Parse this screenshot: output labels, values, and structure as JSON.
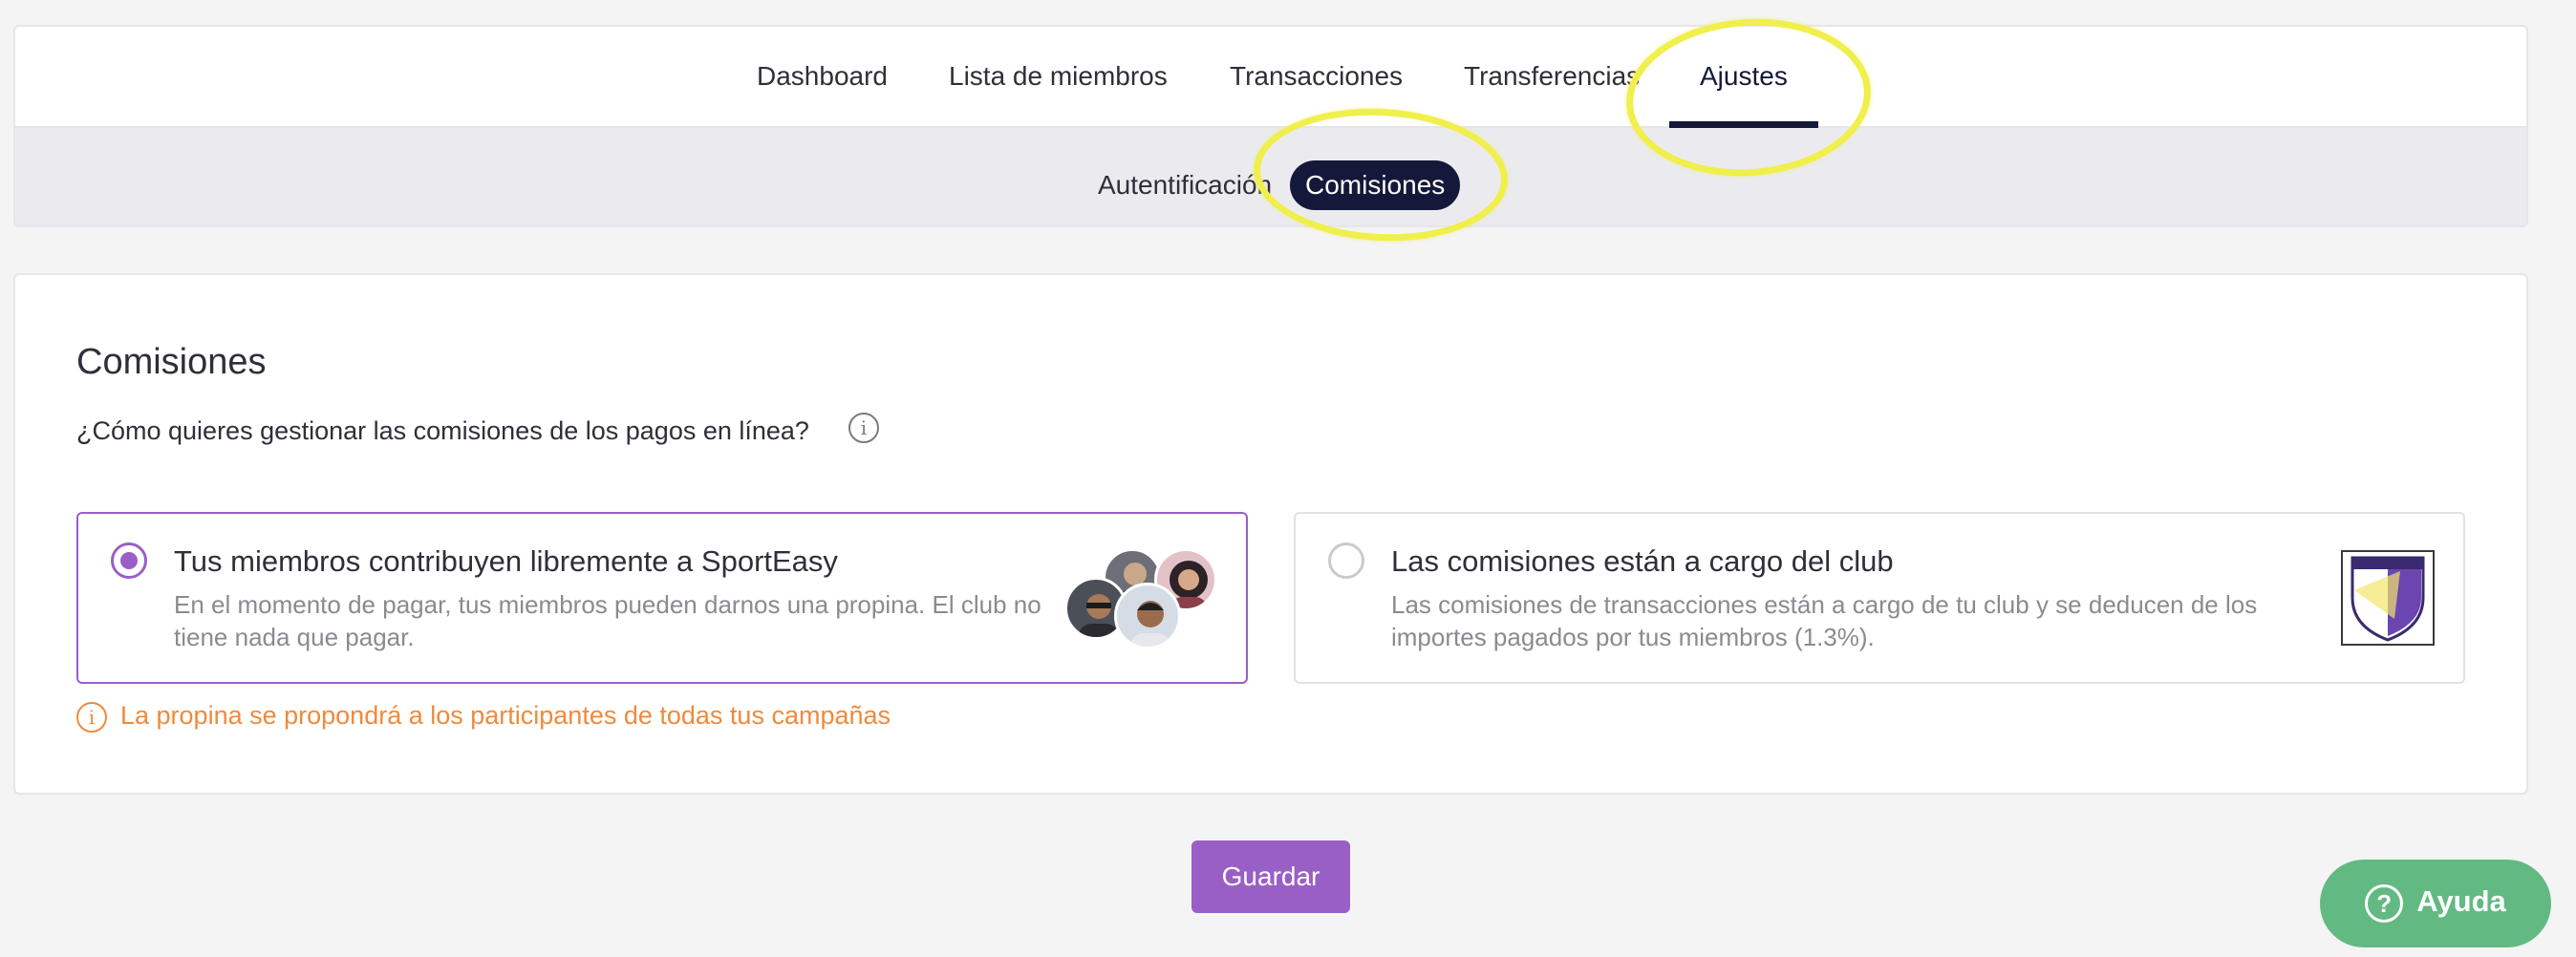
{
  "nav": {
    "tabs": [
      {
        "label": "Dashboard"
      },
      {
        "label": "Lista de miembros"
      },
      {
        "label": "Transacciones"
      },
      {
        "label": "Transferencias"
      },
      {
        "label": "Ajustes"
      }
    ],
    "active_tab": "Ajustes",
    "subtabs": [
      {
        "label": "Autentificación"
      },
      {
        "label": "Comisiones"
      }
    ],
    "active_subtab": "Comisiones"
  },
  "commissions": {
    "title": "Comisiones",
    "question": "¿Cómo quieres gestionar las comisiones de los pagos en línea?",
    "options": [
      {
        "title": "Tus miembros contribuyen libremente a SportEasy",
        "description": "En el momento de pagar, tus miembros pueden darnos una propina. El club no tiene nada que pagar.",
        "selected": true
      },
      {
        "title": "Las comisiones están a cargo del club",
        "description": "Las comisiones de transacciones están a cargo de tu club y se deducen de los importes pagados por tus miembros (1.3%).",
        "selected": false
      }
    ],
    "warning": "La propina se propondrá a los participantes de todas tus campañas"
  },
  "actions": {
    "save_label": "Guardar",
    "help_label": "Ayuda"
  },
  "colors": {
    "accent_purple": "#9a5fc7",
    "nav_dark": "#14183a",
    "warning_orange": "#ef8a3c",
    "help_green": "#63b982",
    "annotation_yellow": "#f0ef4c"
  }
}
